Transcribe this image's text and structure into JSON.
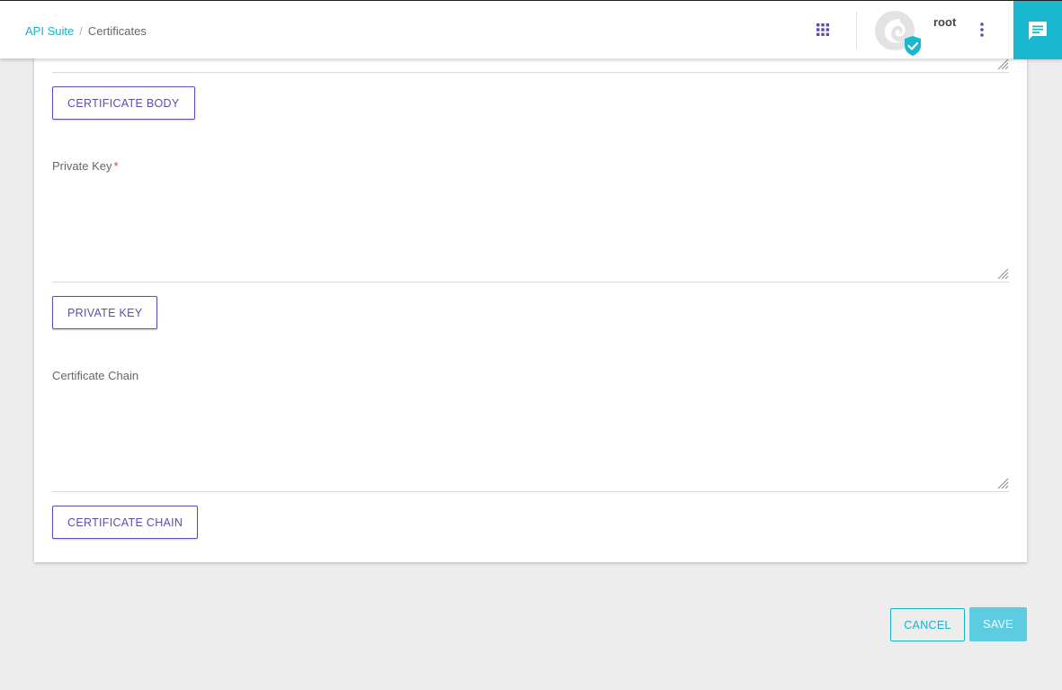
{
  "breadcrumb": {
    "root_label": "API Suite",
    "separator": "/",
    "current_label": "Certificates"
  },
  "user": {
    "name": "root"
  },
  "form": {
    "cert_body_button": "CERTIFICATE BODY",
    "private_key": {
      "label": "Private Key",
      "required_mark": "*",
      "value": "",
      "upload_button": "PRIVATE KEY"
    },
    "cert_chain": {
      "label": "Certificate Chain",
      "value": "",
      "upload_button": "CERTIFICATE CHAIN"
    }
  },
  "actions": {
    "cancel_label": "CANCEL",
    "save_label": "SAVE"
  },
  "icons": {
    "apps": "apps-grid-icon",
    "more": "more-vertical-icon",
    "chat": "chat-icon",
    "verified": "verified-badge-icon",
    "resize": "resize-handle-icon"
  },
  "colors": {
    "accent": "#1ab0c8",
    "primary": "#5a4fb0",
    "save_bg": "#5ccce0",
    "required": "#e53935",
    "background": "#ededed"
  }
}
